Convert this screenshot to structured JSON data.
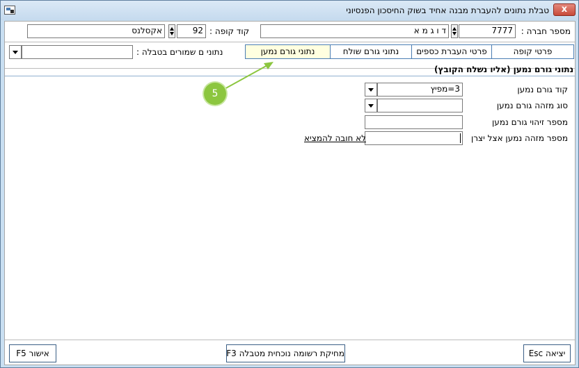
{
  "window": {
    "title": "טבלת נתונים להעברת מבנה אחיד בשוק החיסכון הפנסיוני",
    "close_label": "x"
  },
  "header": {
    "company_label": "מספר חברה :",
    "company_value": "7777",
    "company_name": "ד ו ג מ א",
    "kupa_label": "קוד קופה :",
    "kupa_value": "92",
    "kupa_name": "אקסלנס",
    "saved_data_label": "נתוני ם שמורים בטבלה :",
    "saved_data_value": ""
  },
  "tabs": [
    {
      "label": "פרטי קופה",
      "active": false
    },
    {
      "label": "פרטי העברת כספים",
      "active": false
    },
    {
      "label": "נתוני גורם שולח",
      "active": false
    },
    {
      "label": "נתוני גורם נמען",
      "active": true
    }
  ],
  "section": {
    "title": "נתוני גורם נמען (אליו נשלח הקובץ)",
    "fields": [
      {
        "label": "קוד גורם נמען",
        "value": "3=מפיץ"
      },
      {
        "label": "סוג מזהה גורם נמען",
        "value": ""
      },
      {
        "label": "מספר זיהוי גורם נמען",
        "value": ""
      },
      {
        "label": "מספר מזהה נמען אצל יצרן",
        "value": ""
      }
    ],
    "not_required_link": "לא חובה להמציא"
  },
  "callout": {
    "number": "5"
  },
  "footer": {
    "exit_button": "יציאה Esc",
    "delete_button": "מחיקת רשומה נוכחית מטבלה F3",
    "approve_button": "אישור F5"
  },
  "colors": {
    "window_bg": "#c9dff2",
    "tab_border": "#4a7db3",
    "active_tab_bg": "#ffffe0",
    "callout": "#8cc63f"
  }
}
